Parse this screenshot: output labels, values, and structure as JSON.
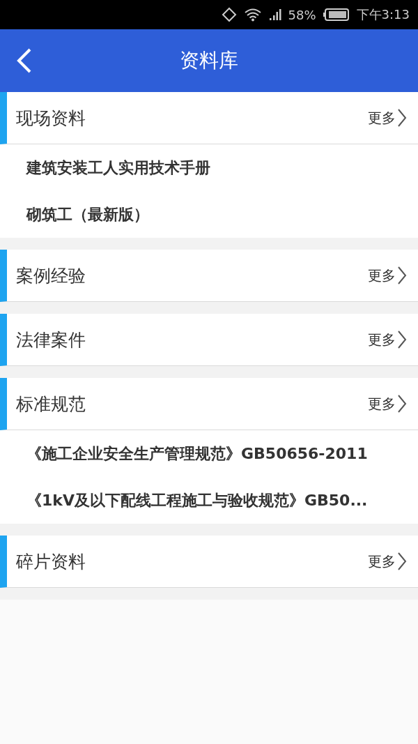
{
  "status_bar": {
    "battery_percent": "58%",
    "time": "下午3:13"
  },
  "app_bar": {
    "title": "资料库"
  },
  "sections": [
    {
      "title": "现场资料",
      "more": "更多",
      "items": [
        "建筑安装工人实用技术手册",
        "砌筑工（最新版）"
      ]
    },
    {
      "title": "案例经验",
      "more": "更多"
    },
    {
      "title": "法律案件",
      "more": "更多"
    },
    {
      "title": "标准规范",
      "more": "更多",
      "items": [
        "《施工企业安全生产管理规范》GB50656-2011",
        "《1kV及以下配线工程施工与验收规范》GB50..."
      ]
    },
    {
      "title": "碎片资料",
      "more": "更多"
    }
  ]
}
